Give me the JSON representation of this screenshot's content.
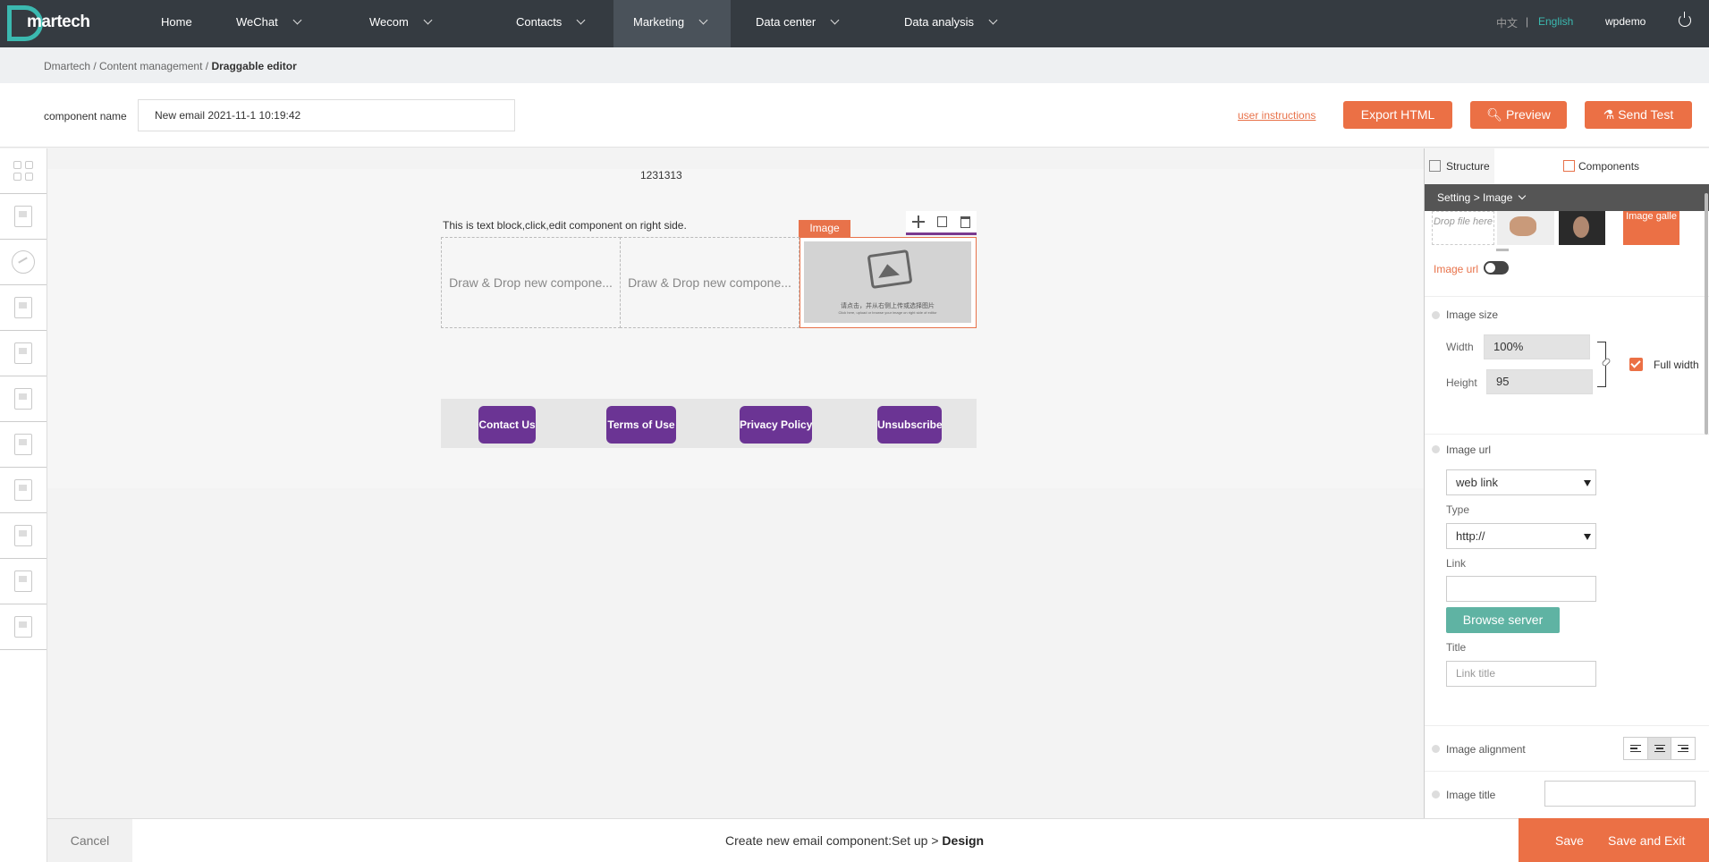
{
  "nav": {
    "logo": "martech",
    "items": [
      {
        "label": "Home",
        "has_menu": false
      },
      {
        "label": "WeChat",
        "has_menu": true
      },
      {
        "label": "Wecom",
        "has_menu": true
      },
      {
        "label": "Contacts",
        "has_menu": true
      },
      {
        "label": "Marketing",
        "has_menu": true,
        "active": true
      },
      {
        "label": "Data center",
        "has_menu": true
      },
      {
        "label": "Data analysis",
        "has_menu": true
      }
    ],
    "lang_zh": "中文",
    "lang_sep": "|",
    "lang_en": "English",
    "user": "wpdemo",
    "accent": "#3bb9b0",
    "icon_power": "power-icon"
  },
  "breadcrumb": {
    "path": "Dmartech / Content management / ",
    "current": "Draggable editor"
  },
  "namebar": {
    "label": "component name",
    "value": "New email 2021-11-1 10:19:42",
    "user_instructions": "user instructions",
    "export_html": "Export HTML",
    "preview": "Preview",
    "send_test": "Send Test",
    "button_color": "#eb7045"
  },
  "rail": {
    "icons": [
      "grid-icon",
      "image-card-icon",
      "chart-icon",
      "gallery-icon",
      "layout-icon",
      "code-icon",
      "page-icon",
      "image-card-icon",
      "gallery-icon",
      "layout-icon",
      "code-icon"
    ]
  },
  "canvas": {
    "top_text": "1231313",
    "text_block": "This is text block,click,edit component on right side.",
    "dropzone_1": "Draw & Drop new compone...",
    "dropzone_2": "Draw & Drop new compone...",
    "image_tag": "Image",
    "image_caption_cn": "请点击，并从右侧上传或选择图片",
    "image_caption_en": "Click here, upload or browse your image on right side of editor",
    "footer_buttons": [
      "Contact Us",
      "Terms of Use",
      "Privacy Policy",
      "Unsubscribe"
    ],
    "footer_button_color": "#6b3494"
  },
  "panel": {
    "tab_structure": "Structure",
    "tab_components": "Components",
    "setting": "Setting > Image",
    "drop_file": "Drop file here",
    "gallery_button": "Image galle",
    "image_url_toggle": "Image url",
    "image_size": "Image size",
    "width_label": "Width",
    "width_value": "100%",
    "height_label": "Height",
    "height_value": "95",
    "full_width": "Full width",
    "image_url_section": "Image url",
    "link_type": "web link",
    "type_label": "Type",
    "type_value": "http://",
    "link_label": "Link",
    "link_value": "",
    "browse_server": "Browse server",
    "title_label": "Title",
    "title_placeholder": "Link title",
    "image_alignment": "Image alignment",
    "image_title": "Image title",
    "image_title_value": ""
  },
  "bottom": {
    "cancel": "Cancel",
    "steps_prefix": "Create new email component:Set up > ",
    "steps_current": "Design",
    "save": "Save",
    "save_and_exit": "Save and Exit"
  }
}
